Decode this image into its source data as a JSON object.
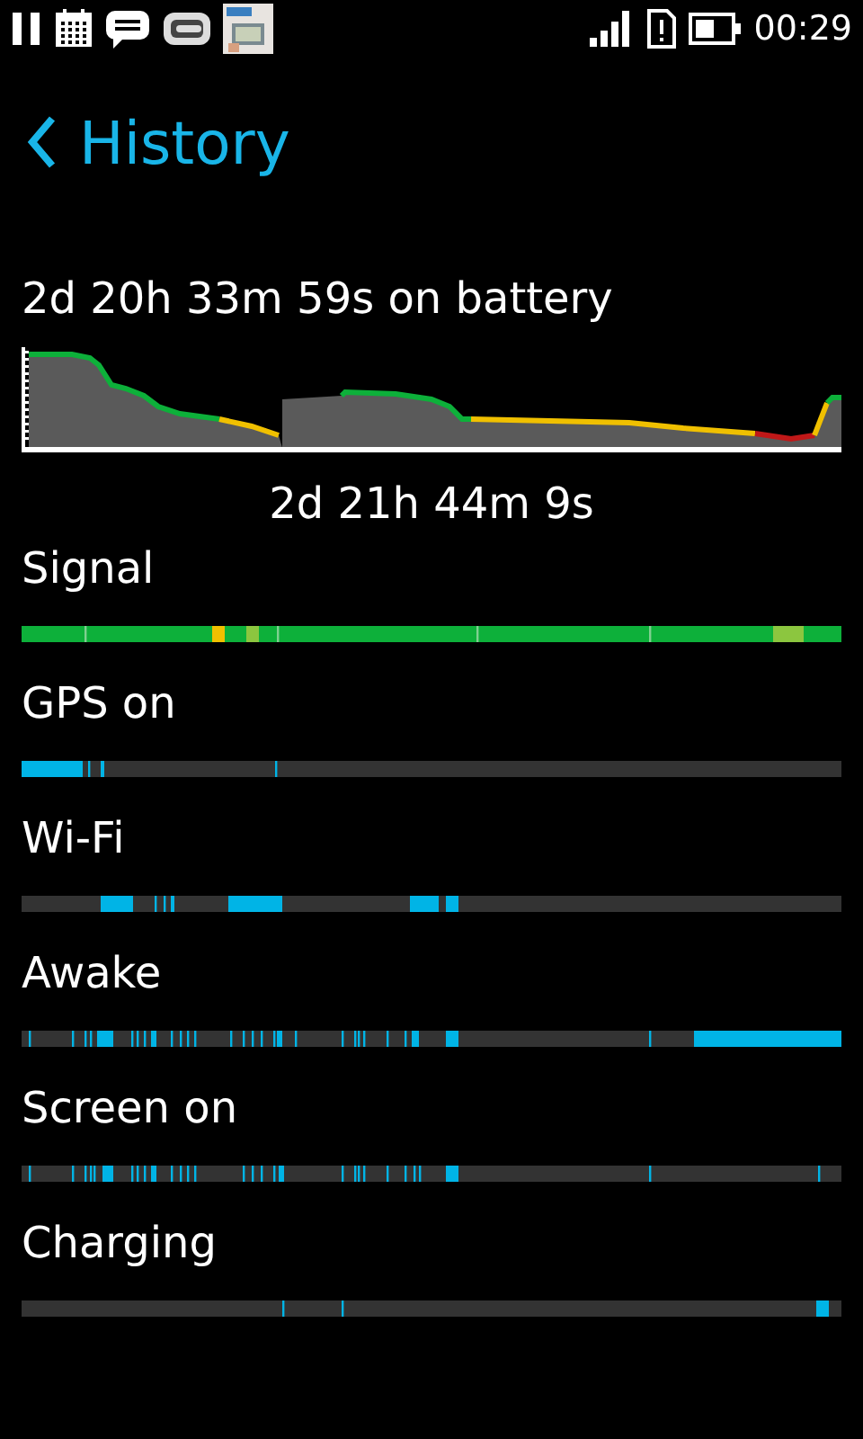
{
  "status_bar": {
    "time": "00:29"
  },
  "header": {
    "title": "History"
  },
  "battery": {
    "summary": "2d 20h 33m 59s on battery",
    "duration": "2d 21h 44m 9s"
  },
  "tracks": [
    {
      "label": "Signal",
      "kind": "signal"
    },
    {
      "label": "GPS on",
      "kind": "activity"
    },
    {
      "label": "Wi-Fi",
      "kind": "activity"
    },
    {
      "label": "Awake",
      "kind": "activity"
    },
    {
      "label": "Screen on",
      "kind": "activity"
    },
    {
      "label": "Charging",
      "kind": "activity"
    }
  ]
}
